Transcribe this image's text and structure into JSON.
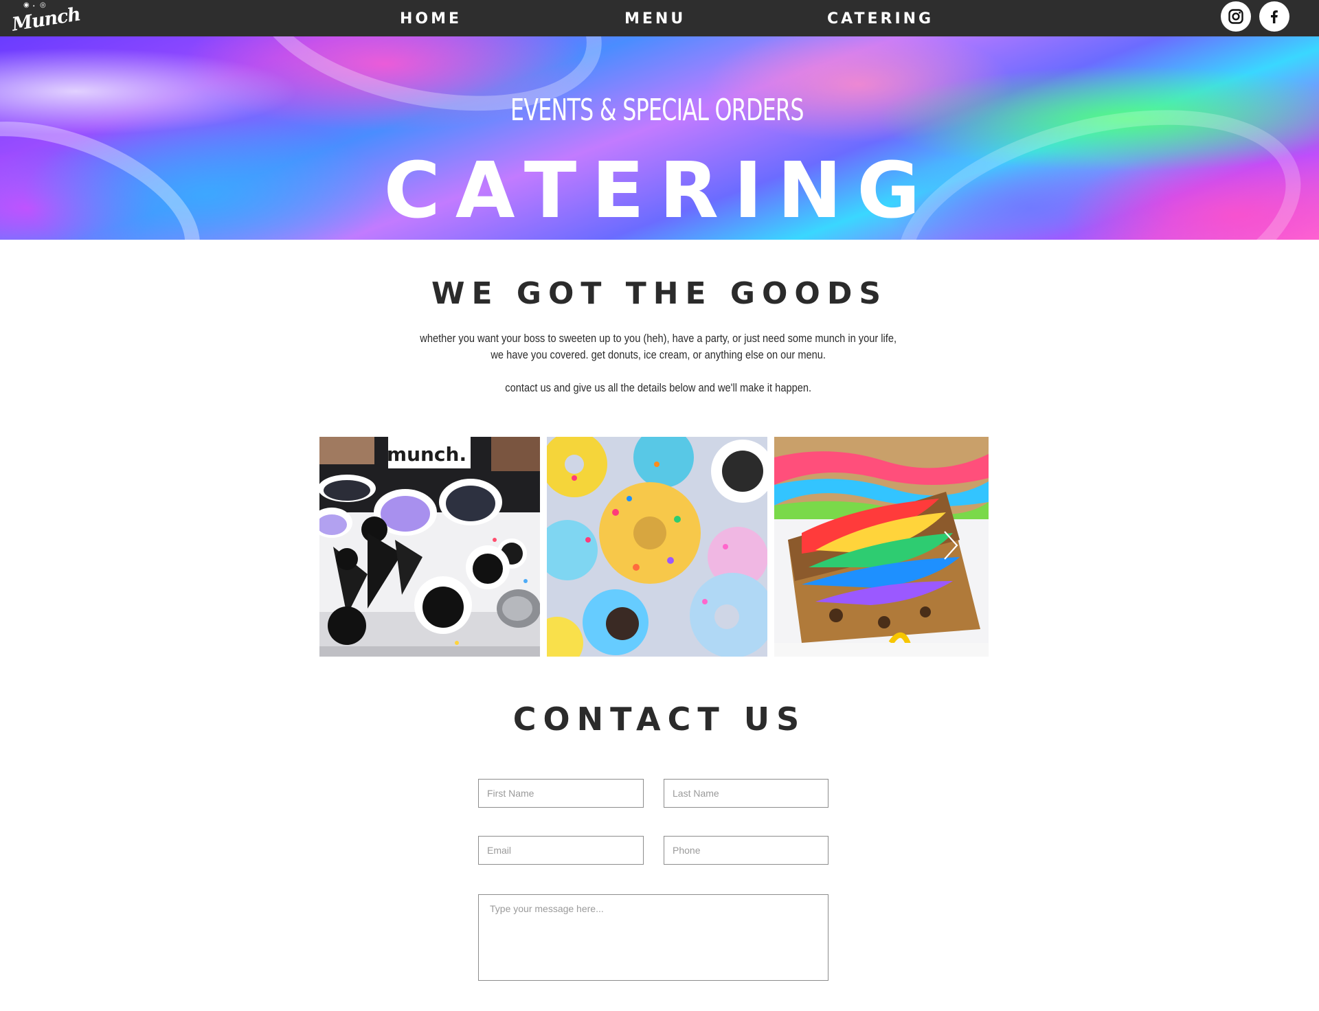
{
  "brand": {
    "logo_text": "Munch"
  },
  "nav": {
    "links": [
      {
        "label": "HOME"
      },
      {
        "label": "MENU"
      },
      {
        "label": "CATERING"
      }
    ],
    "social": [
      {
        "icon": "instagram-icon"
      },
      {
        "icon": "facebook-icon"
      }
    ]
  },
  "hero": {
    "subtitle": "EVENTS & SPECIAL ORDERS",
    "title": "CATERING"
  },
  "goods": {
    "heading": "WE GOT THE GOODS",
    "line1": "whether you want your boss to sweeten up to you (heh), have a party, or just need some munch in your life,",
    "line2": "we have you covered. get donuts, ice cream, or anything else on our menu.",
    "line3": "contact us and give us all the details below and we'll make it happen."
  },
  "gallery": {
    "items": [
      {
        "shirt_text": "munch."
      },
      {
        "alt": "donuts"
      },
      {
        "alt": "rainbow bars"
      }
    ],
    "next_icon": "chevron-right-icon"
  },
  "contact": {
    "heading": "CONTACT US",
    "first_name_placeholder": "First Name",
    "last_name_placeholder": "Last Name",
    "email_placeholder": "Email",
    "phone_placeholder": "Phone",
    "message_placeholder": "Type your message here..."
  },
  "colors": {
    "nav_bg": "#2e2e2e",
    "text_dark": "#2b2b2b",
    "field_border": "#8c8c8c"
  }
}
